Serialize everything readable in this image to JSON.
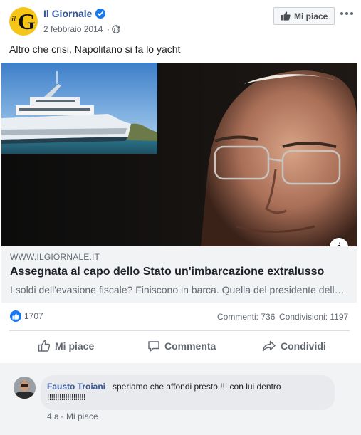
{
  "page": {
    "name": "Il Giornale",
    "logo_text_small": "il",
    "logo_text_big": "G",
    "date": "2 febbraio 2014",
    "dot": "·",
    "like_button_label": "Mi piace",
    "more_icon": "more-horizontal-icon",
    "verified_icon": "verified-badge-icon",
    "privacy_icon": "globe-icon"
  },
  "post": {
    "text": "Altro che crisi, Napolitano si fa lo yacht"
  },
  "link_preview": {
    "domain": "WWW.ILGIORNALE.IT",
    "title": "Assegnata al capo dello Stato un'imbarcazione extralusso",
    "description": "I soldi dell'evasione fiscale? Finiscono in barca. Quella del presidente della Repubblica",
    "info_icon_label": "i"
  },
  "stats": {
    "reactions": "1707",
    "comments": "Commenti: 736",
    "shares": "Condivisioni: 1197"
  },
  "actions": {
    "like": "Mi piace",
    "comment": "Commenta",
    "share": "Condividi"
  },
  "comment": {
    "author": "Fausto Troiani",
    "text_line1": "speriamo che affondi presto !!! con lui dentro",
    "text_line2": "!!!!!!!!!!!!!!!!!!!",
    "time": "4 a",
    "dot": "·",
    "like_label": "Mi piace"
  },
  "colors": {
    "brand_blue": "#385898",
    "like_blue": "#1877f2",
    "logo_yellow": "#f5c518",
    "link_box_bg": "#f2f3f5"
  }
}
